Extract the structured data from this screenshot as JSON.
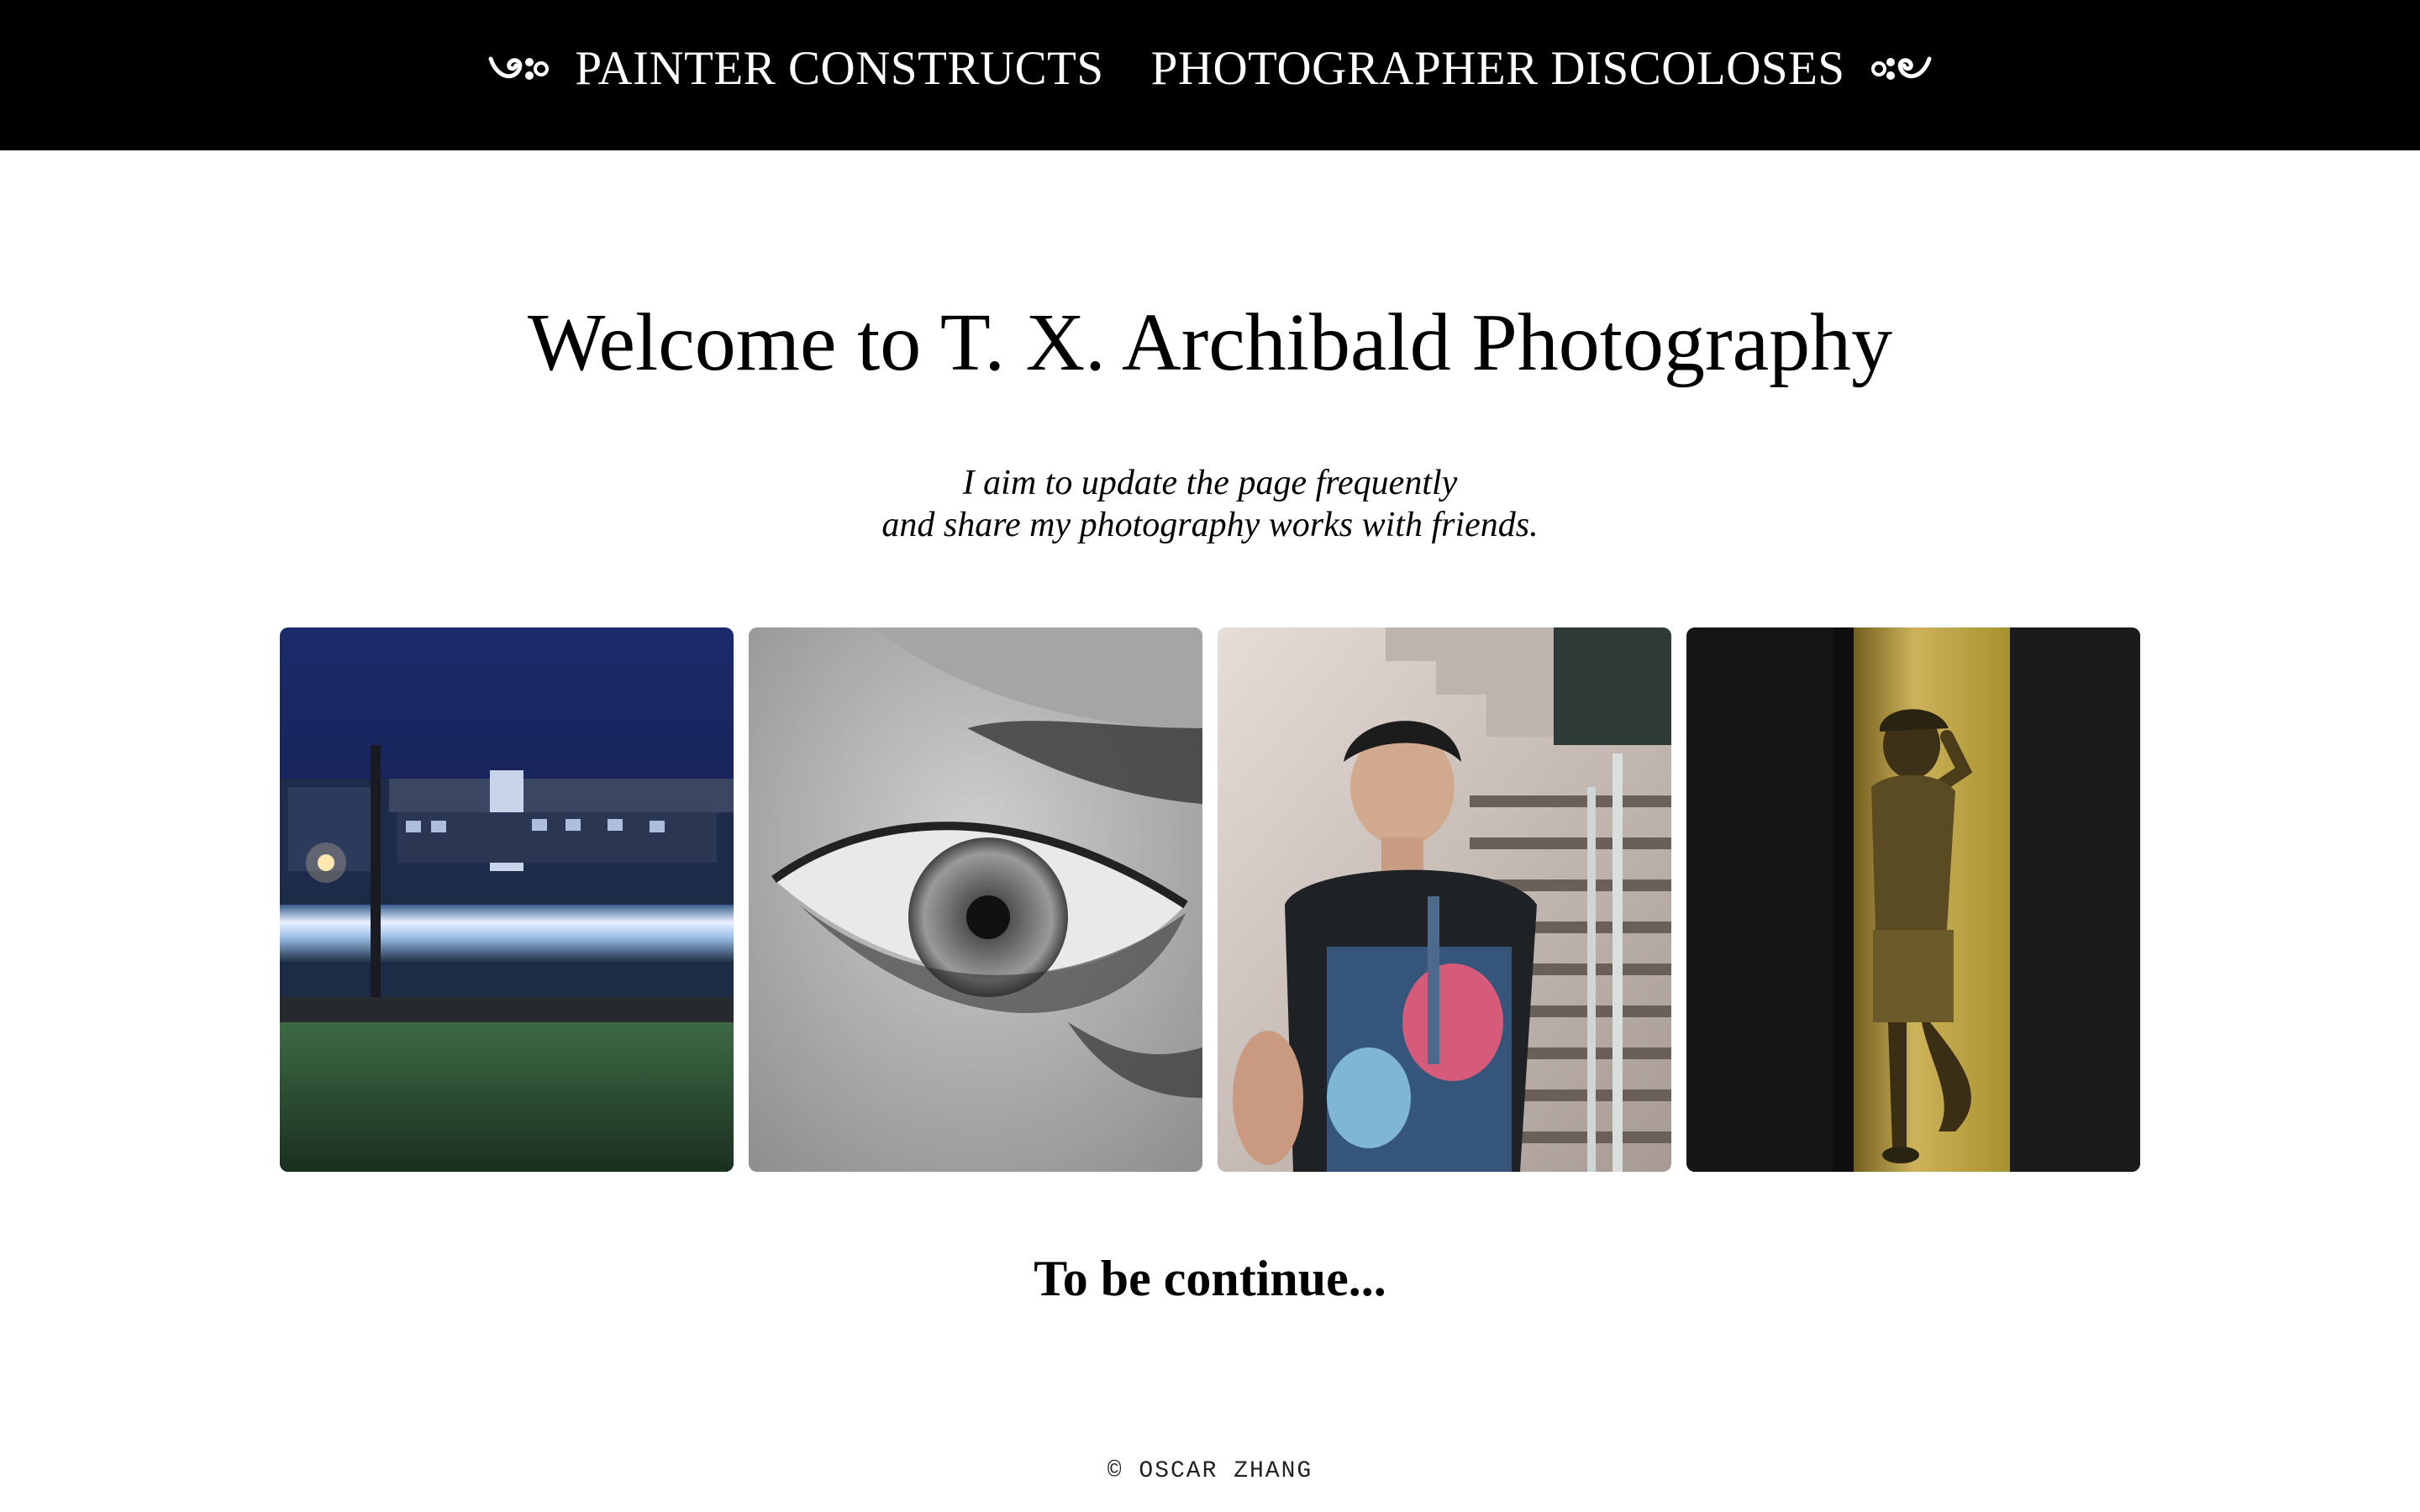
{
  "nav": {
    "left_ornament_icon": "swirl-ornament-icon",
    "right_ornament_icon": "swirl-ornament-icon",
    "links": [
      {
        "label": "PAINTER CONSTRUCTS"
      },
      {
        "label": "PHOTOGRAPHER DISCOLOSES"
      }
    ]
  },
  "main": {
    "title": "Welcome to T. X. Archibald Photography",
    "subtitle_line1": "I aim to update the page frequently",
    "subtitle_line2": "and share my photography works with friends.",
    "continue_text": "To be continue..."
  },
  "gallery": {
    "photos": [
      {
        "subject": "night train long exposure",
        "accent": "#1d2b5e"
      },
      {
        "subject": "black and white eye close-up",
        "accent": "#9a9a9a"
      },
      {
        "subject": "young man by concrete staircase",
        "accent": "#c9b7ad"
      },
      {
        "subject": "figure in yellow light at doorway",
        "accent": "#b89a3c"
      }
    ]
  },
  "footer": {
    "copyright": "© OSCAR ZHANG"
  },
  "colors": {
    "nav_background": "#000000",
    "page_background": "#ffffff",
    "text": "#000000"
  }
}
